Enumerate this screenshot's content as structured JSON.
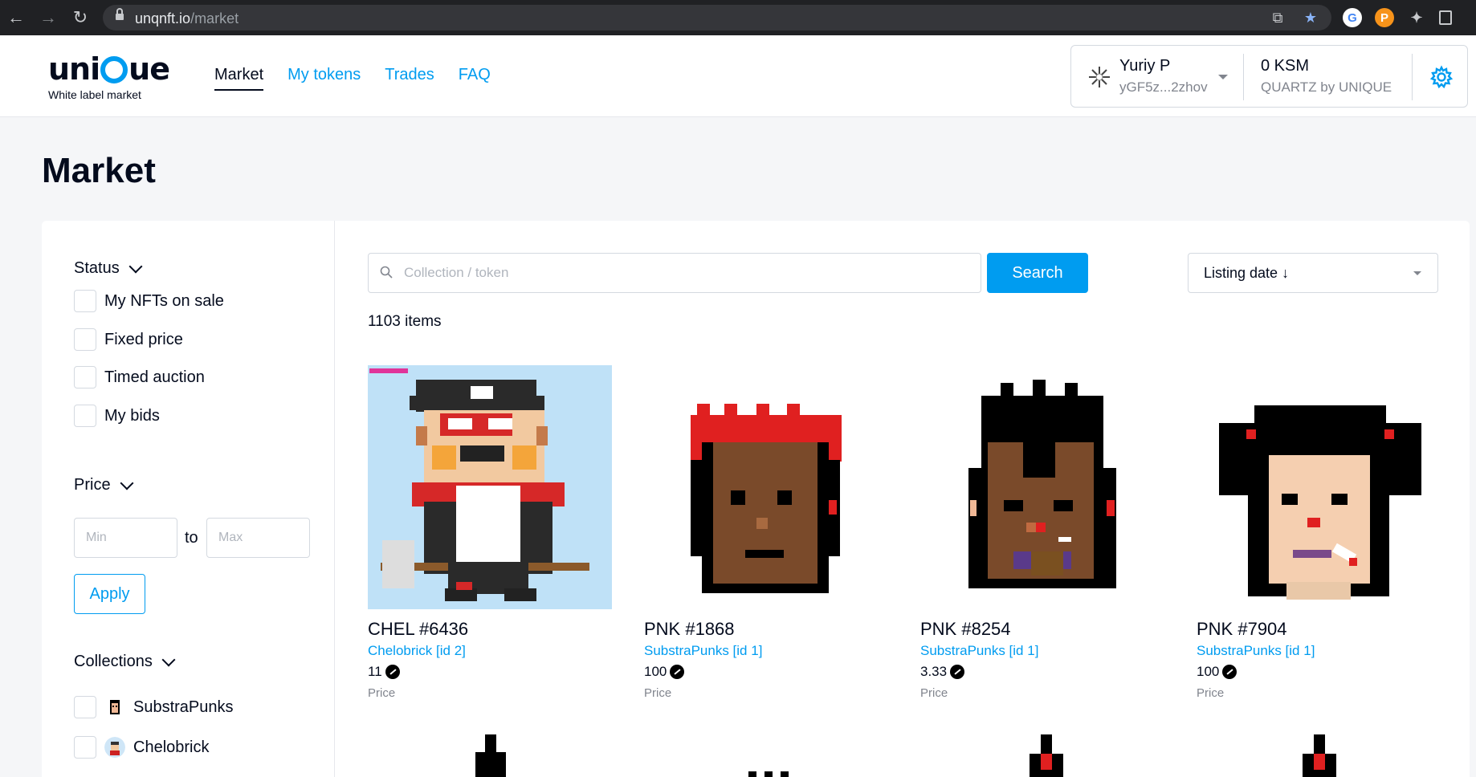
{
  "browser": {
    "url_host": "unqnft.io",
    "url_path": "/market"
  },
  "header": {
    "logo_word_left": "uni",
    "logo_word_right": "ue",
    "logo_tagline": "White label market",
    "nav": [
      {
        "label": "Market",
        "active": true
      },
      {
        "label": "My tokens",
        "active": false
      },
      {
        "label": "Trades",
        "active": false
      },
      {
        "label": "FAQ",
        "active": false
      }
    ],
    "account": {
      "name": "Yuriy P",
      "address": "yGF5z...2zhov",
      "balance": "0 KSM",
      "network": "QUARTZ by UNIQUE"
    }
  },
  "page": {
    "title": "Market"
  },
  "filters": {
    "status": {
      "title": "Status",
      "options": [
        "My NFTs on sale",
        "Fixed price",
        "Timed auction",
        "My bids"
      ]
    },
    "price": {
      "title": "Price",
      "min_placeholder": "Min",
      "to_label": "to",
      "max_placeholder": "Max",
      "apply_label": "Apply"
    },
    "collections": {
      "title": "Collections",
      "items": [
        "SubstraPunks",
        "Chelobrick"
      ]
    }
  },
  "search": {
    "placeholder": "Collection / token",
    "button_label": "Search"
  },
  "sort": {
    "label": "Listing date ↓"
  },
  "results": {
    "count_label": "1103 items",
    "tokens": [
      {
        "name": "CHEL #6436",
        "collection": "Chelobrick [id 2]",
        "price": "11",
        "price_label": "Price"
      },
      {
        "name": "PNK #1868",
        "collection": "SubstraPunks [id 1]",
        "price": "100",
        "price_label": "Price"
      },
      {
        "name": "PNK #8254",
        "collection": "SubstraPunks [id 1]",
        "price": "3.33",
        "price_label": "Price"
      },
      {
        "name": "PNK #7904",
        "collection": "SubstraPunks [id 1]",
        "price": "100",
        "price_label": "Price"
      }
    ]
  },
  "colors": {
    "accent": "#009cf0",
    "text": "#040b1d",
    "muted": "#81858e",
    "border": "#d4d9e0"
  }
}
